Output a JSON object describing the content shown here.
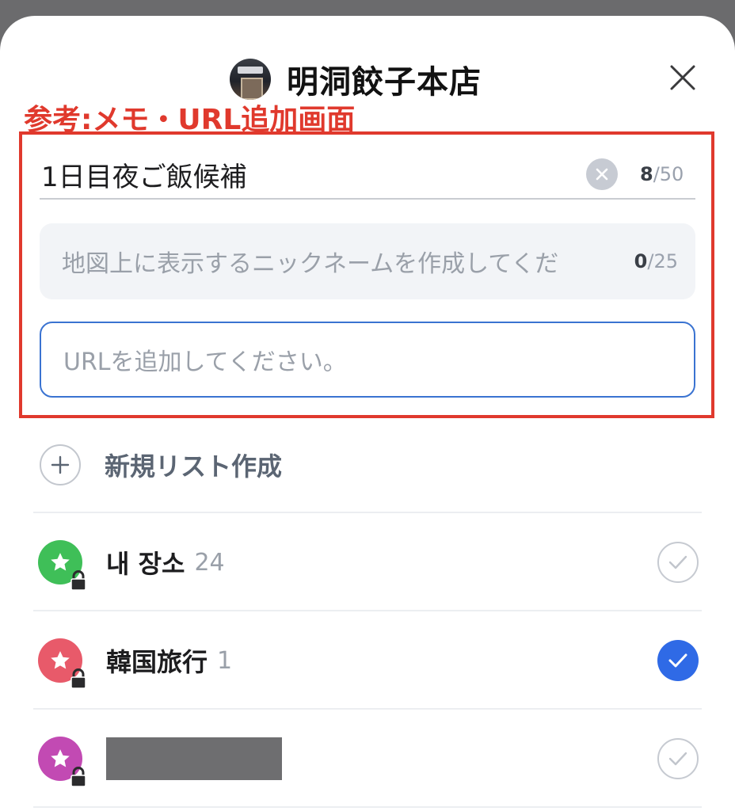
{
  "header": {
    "title": "明洞餃子本店",
    "close_icon": "close-icon"
  },
  "annotation": "参考:メモ・URL追加画面",
  "memo": {
    "value": "1日目夜ご飯候補",
    "count_current": "8",
    "count_max": "/50"
  },
  "nickname": {
    "placeholder": "地図上に表示するニックネームを作成してくだ",
    "count_current": "0",
    "count_max": "/25"
  },
  "url": {
    "placeholder": "URLを追加してください。"
  },
  "new_list": {
    "label": "新規リスト作成"
  },
  "lists": [
    {
      "name": "내 장소",
      "count": "24",
      "color": "#3fbf58",
      "checked": false
    },
    {
      "name": "韓国旅行",
      "count": "1",
      "color": "#e85a6a",
      "checked": true
    },
    {
      "name": "",
      "count": "",
      "color": "#c24ab3",
      "checked": false,
      "redacted": true
    }
  ],
  "colors": {
    "accent": "#2f6ae6",
    "annotation": "#e0392d"
  }
}
